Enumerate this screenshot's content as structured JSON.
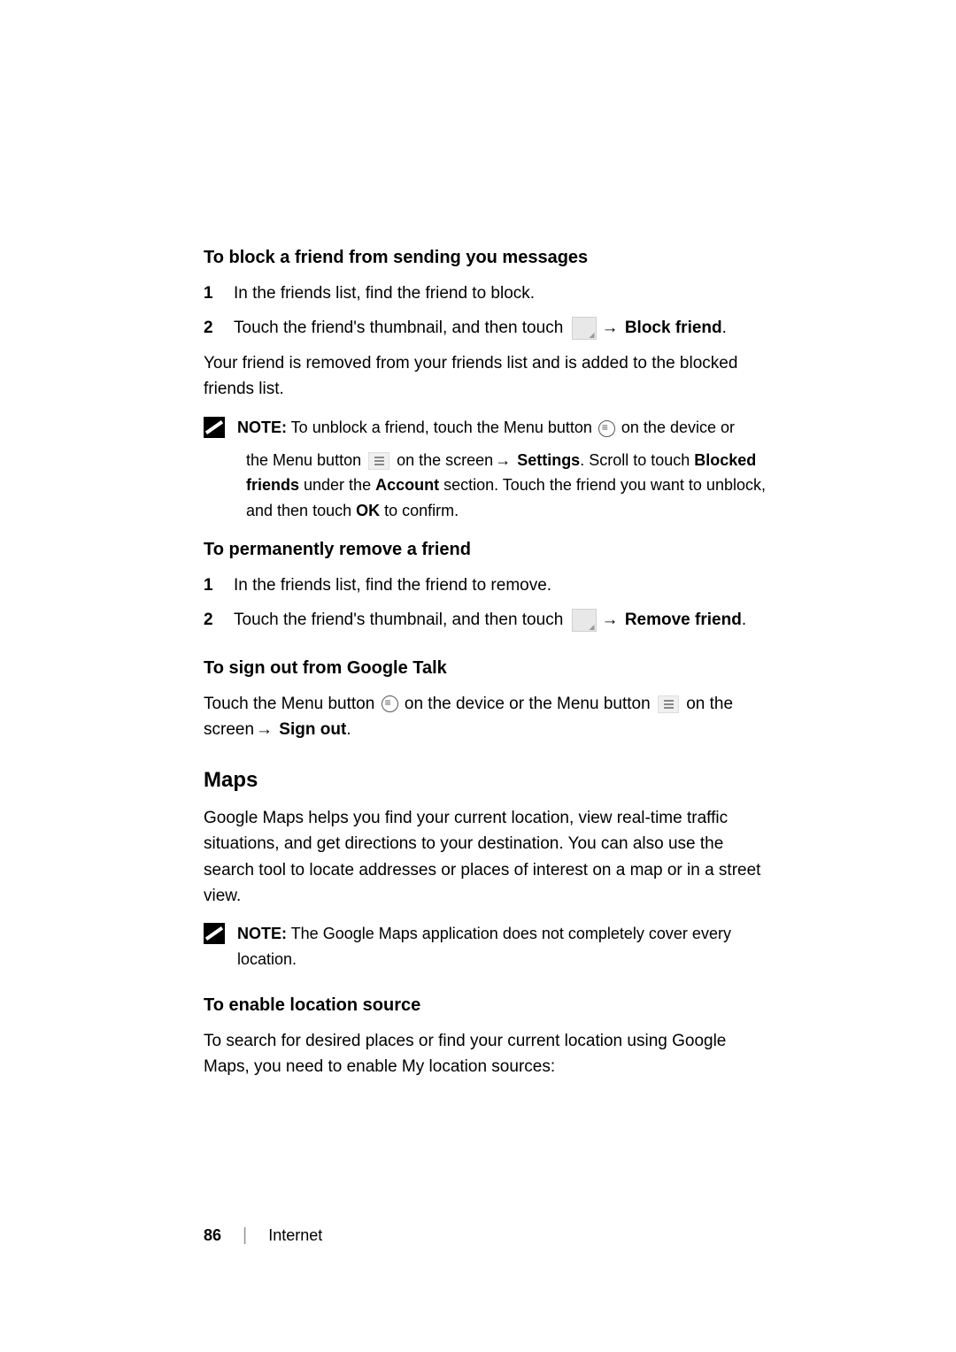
{
  "section1": {
    "heading": "To block a friend from sending you messages",
    "step1_num": "1",
    "step1_text": "In the friends list, find the friend to block.",
    "step2_num": "2",
    "step2_a": "Touch the friend's thumbnail, and then touch ",
    "step2_b": " Block friend",
    "step2_c": "."
  },
  "para1": "Your friend is removed from your friends list and is added to the blocked friends list.",
  "note1": {
    "label": "NOTE:",
    "line1a": " To unblock a friend, touch the Menu button ",
    "line1b": " on the device or",
    "line2a": "the Menu button ",
    "line2b": " on the screen",
    "line2c": " Settings",
    "line2d": ". Scroll to touch ",
    "line2e": "Blocked friends",
    "line2f": " under the ",
    "line2g": "Account",
    "line2h": " section. Touch the friend you want to unblock, and then touch ",
    "line2i": "OK",
    "line2j": " to confirm."
  },
  "section2": {
    "heading": "To permanently remove a friend",
    "step1_num": "1",
    "step1_text": "In the friends list, find the friend to remove.",
    "step2_num": "2",
    "step2_a": "Touch the friend's thumbnail, and then touch ",
    "step2_b": " Remove friend",
    "step2_c": "."
  },
  "section3": {
    "heading": "To sign out from Google Talk",
    "text_a": "Touch the Menu button ",
    "text_b": " on the device or the Menu button ",
    "text_c": " on the screen",
    "text_d": " Sign out",
    "text_e": "."
  },
  "maps": {
    "heading": "Maps",
    "para": "Google Maps helps you find your current location, view real-time traffic situations, and get directions to your destination. You can also use the search tool to locate addresses or places of interest on a map or in a street view."
  },
  "note2": {
    "label": "NOTE:",
    "text": " The Google Maps application does not completely cover every location."
  },
  "section4": {
    "heading": "To enable location source",
    "para": "To search for desired places or find your current location using Google Maps, you need to enable My location sources:"
  },
  "arrow": "→",
  "footer": {
    "page": "86",
    "sep": "|",
    "label": "Internet"
  }
}
